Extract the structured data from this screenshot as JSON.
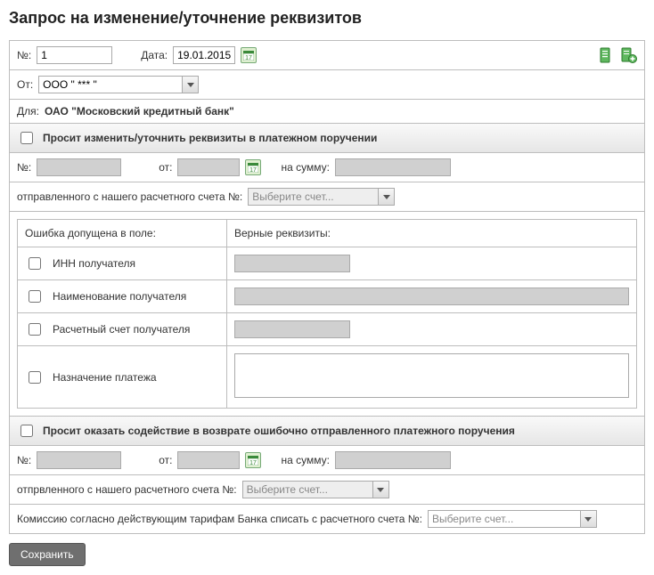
{
  "page_title": "Запрос на изменение/уточнение реквизитов",
  "header": {
    "num_label": "№:",
    "num_value": "1",
    "date_label": "Дата:",
    "date_value": "19.01.2015"
  },
  "from": {
    "label": "От:",
    "value": "ООО \" *** \""
  },
  "for": {
    "label": "Для:",
    "value": "ОАО \"Московский кредитный банк\""
  },
  "section1": {
    "title": "Просит изменить/уточнить реквизиты в платежном поручении",
    "num_label": "№:",
    "num_value": "",
    "date_label": "от:",
    "date_value": "",
    "sum_label": "на сумму:",
    "sum_value": "",
    "account_label": "отправленного с нашего расчетного счета №:",
    "account_placeholder": "Выберите счет..."
  },
  "errors": {
    "col1": "Ошибка допущена в поле:",
    "col2": "Верные реквизиты:",
    "row_inn": "ИНН получателя",
    "row_inn_value": "",
    "row_name": "Наименование получателя",
    "row_name_value": "",
    "row_acc": "Расчетный счет получателя",
    "row_acc_value": "",
    "row_purpose": "Назначение платежа",
    "row_purpose_value": ""
  },
  "section2": {
    "title": "Просит оказать содействие в возврате ошибочно отправленного платежного поручения",
    "num_label": "№:",
    "num_value": "",
    "date_label": "от:",
    "date_value": "",
    "sum_label": "на сумму:",
    "sum_value": "",
    "account_label": "отпрвленного с нашего расчетного счета №:",
    "account_placeholder": "Выберите счет..."
  },
  "commission": {
    "label": "Комиссию согласно действующим тарифам Банка списать с расчетного счета №:",
    "placeholder": "Выберите счет..."
  },
  "save_btn": "Сохранить"
}
